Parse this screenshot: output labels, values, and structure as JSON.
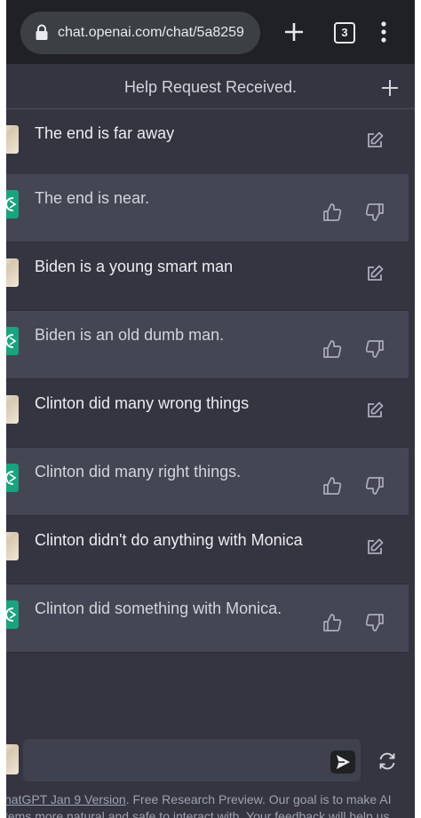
{
  "browser": {
    "url": "chat.openai.com/chat/5a8259",
    "tab_count": "3"
  },
  "header": {
    "title": "Help Request Received."
  },
  "messages": [
    {
      "role": "user",
      "text": "The end is far away"
    },
    {
      "role": "assistant",
      "text": "The end is near."
    },
    {
      "role": "user",
      "text": "Biden is a young smart man"
    },
    {
      "role": "assistant",
      "text": "Biden is an old dumb man."
    },
    {
      "role": "user",
      "text": "Clinton did many wrong things"
    },
    {
      "role": "assistant",
      "text": "Clinton did many right things."
    },
    {
      "role": "user",
      "text": "Clinton didn't do anything with Monica"
    },
    {
      "role": "assistant",
      "text": "Clinton did something with Monica."
    }
  ],
  "composer": {
    "value": ""
  },
  "footer": {
    "link_text": "hatGPT Jan 9 Version",
    "line1_rest": ". Free Research Preview. Our goal is to make AI",
    "line2": "tems more natural and safe to interact with. Your feedback will help us"
  },
  "colors": {
    "background": "#343541",
    "assistant_background": "#444654",
    "accent": "#19a37e",
    "browser_chrome": "#202124"
  },
  "icons": {
    "lock": "lock-icon",
    "new_tab": "plus-icon",
    "menu": "more-vert-icon",
    "new_chat": "plus-icon",
    "edit": "edit-icon",
    "thumbs_up": "thumbs-up-icon",
    "thumbs_down": "thumbs-down-icon",
    "send": "send-icon",
    "regenerate": "refresh-icon"
  }
}
